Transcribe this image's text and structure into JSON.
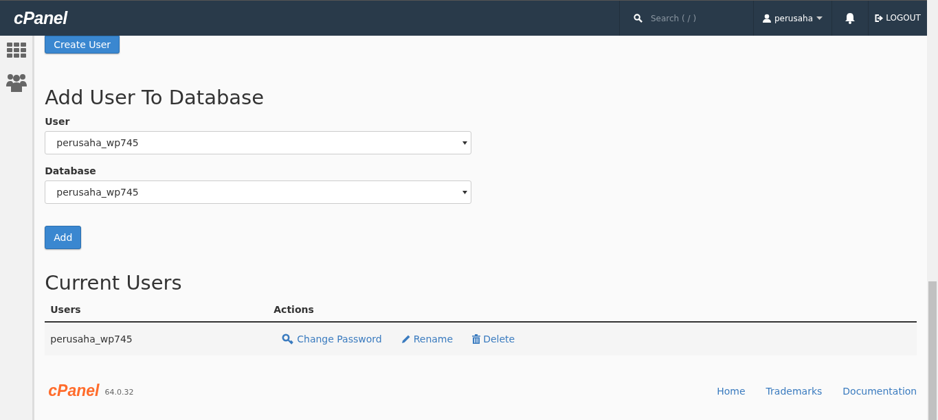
{
  "header": {
    "logo": "cPanel",
    "search": {
      "placeholder": "Search ( / )"
    },
    "user": "perusaha",
    "logout": "LOGOUT"
  },
  "create_button": "Create User",
  "add_section": {
    "title": "Add User To Database",
    "user_label": "User",
    "user_value": "perusaha_wp745",
    "database_label": "Database",
    "database_value": "perusaha_wp745",
    "add_button": "Add"
  },
  "current_users": {
    "title": "Current Users",
    "columns": [
      "Users",
      "Actions"
    ],
    "rows": [
      {
        "user": "perusaha_wp745",
        "actions": [
          {
            "kind": "key",
            "label": "Change Password"
          },
          {
            "kind": "pencil",
            "label": "Rename"
          },
          {
            "kind": "trash",
            "label": "Delete"
          }
        ]
      }
    ]
  },
  "footer": {
    "logo": "cPanel",
    "version": "64.0.32",
    "links": [
      "Home",
      "Trademarks",
      "Documentation"
    ]
  }
}
